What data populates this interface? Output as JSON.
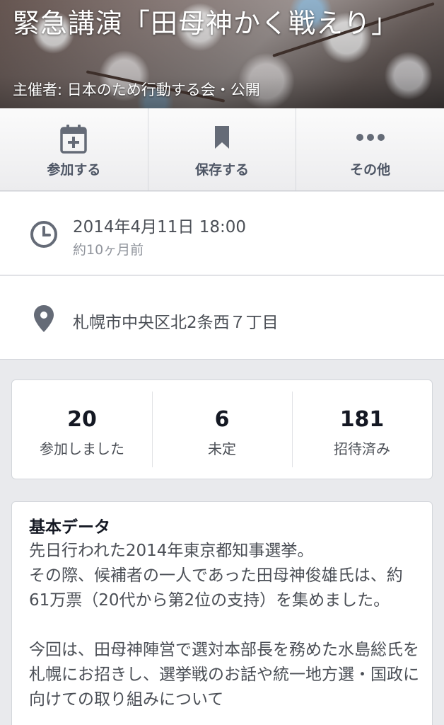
{
  "cover": {
    "title": "緊急講演「田母神かく戦えり」",
    "subtitle": "主催者: 日本のため行動する会・公開"
  },
  "actions": [
    {
      "label": "参加する",
      "icon": "calendar-add-icon"
    },
    {
      "label": "保存する",
      "icon": "bookmark-icon"
    },
    {
      "label": "その他",
      "icon": "more-dots-icon"
    }
  ],
  "time": {
    "datetime": "2014年4月11日 18:00",
    "relative": "約10ヶ月前",
    "icon": "clock-icon"
  },
  "place": {
    "address": "札幌市中央区北2条西７丁目",
    "icon": "location-pin-icon"
  },
  "stats": [
    {
      "count": "20",
      "label": "参加しました"
    },
    {
      "count": "6",
      "label": "未定"
    },
    {
      "count": "181",
      "label": "招待済み"
    }
  ],
  "details": {
    "heading": "基本データ",
    "paragraphs": [
      "先日行われた2014年東京都知事選挙。",
      "その際、候補者の一人であった田母神俊雄氏は、約61万票（20代から第2位の支持）を集めました。",
      "",
      "今回は、田母神陣営で選対本部長を務めた水島総氏を札幌にお招きし、選挙戦のお話や統一地方選・国政に向けての取り組みについて"
    ]
  },
  "colors": {
    "background": "#e9eaed",
    "icon_gray": "#656b77",
    "text_primary": "#141823",
    "text_secondary": "#4b4f56",
    "text_muted": "#90949c"
  }
}
